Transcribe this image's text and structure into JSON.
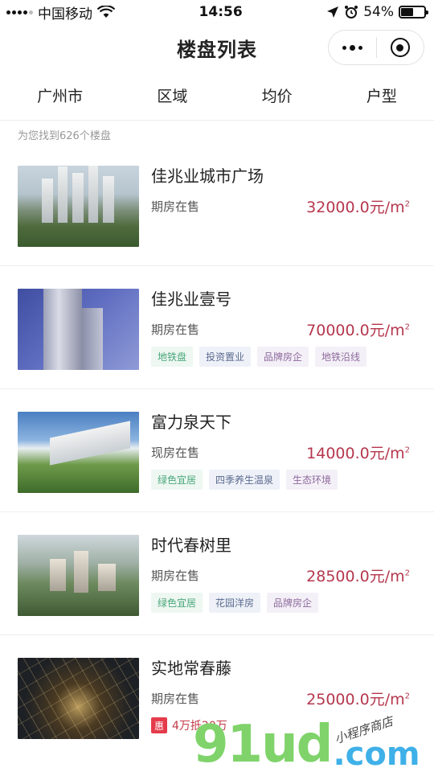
{
  "status_bar": {
    "carrier": "中国移动",
    "time": "14:56",
    "battery": "54%",
    "battery_level": 0.54
  },
  "nav": {
    "title": "楼盘列表"
  },
  "filters": [
    "广州市",
    "区域",
    "均价",
    "户型"
  ],
  "result_count": "为您找到626个楼盘",
  "listings": [
    {
      "name": "佳兆业城市广场",
      "status": "期房在售",
      "price": "32000.0元/m",
      "price_unit_sup": "2",
      "tags": []
    },
    {
      "name": "佳兆业壹号",
      "status": "期房在售",
      "price": "70000.0元/m",
      "price_unit_sup": "2",
      "tags": [
        {
          "label": "地铁盘",
          "color": "green"
        },
        {
          "label": "投资置业",
          "color": "blue"
        },
        {
          "label": "品牌房企",
          "color": "purple"
        },
        {
          "label": "地铁沿线",
          "color": "purple"
        }
      ]
    },
    {
      "name": "富力泉天下",
      "status": "现房在售",
      "price": "14000.0元/m",
      "price_unit_sup": "2",
      "tags": [
        {
          "label": "绿色宜居",
          "color": "green"
        },
        {
          "label": "四季养生温泉",
          "color": "blue"
        },
        {
          "label": "生态环境",
          "color": "purple"
        }
      ]
    },
    {
      "name": "时代春树里",
      "status": "期房在售",
      "price": "28500.0元/m",
      "price_unit_sup": "2",
      "tags": [
        {
          "label": "绿色宜居",
          "color": "green"
        },
        {
          "label": "花园洋房",
          "color": "blue"
        },
        {
          "label": "品牌房企",
          "color": "purple"
        }
      ]
    },
    {
      "name": "实地常春藤",
      "status": "期房在售",
      "price": "25000.0元/m",
      "price_unit_sup": "2",
      "promo": {
        "badge": "惠",
        "text": "4万抵20万"
      }
    }
  ],
  "watermark": {
    "logo": "91ud",
    "suffix": ".com",
    "tagline": "小程序商店"
  },
  "colors": {
    "price": "#b5374d",
    "tag_green": "#4aa77a",
    "promo_badge": "#e43b4b"
  }
}
